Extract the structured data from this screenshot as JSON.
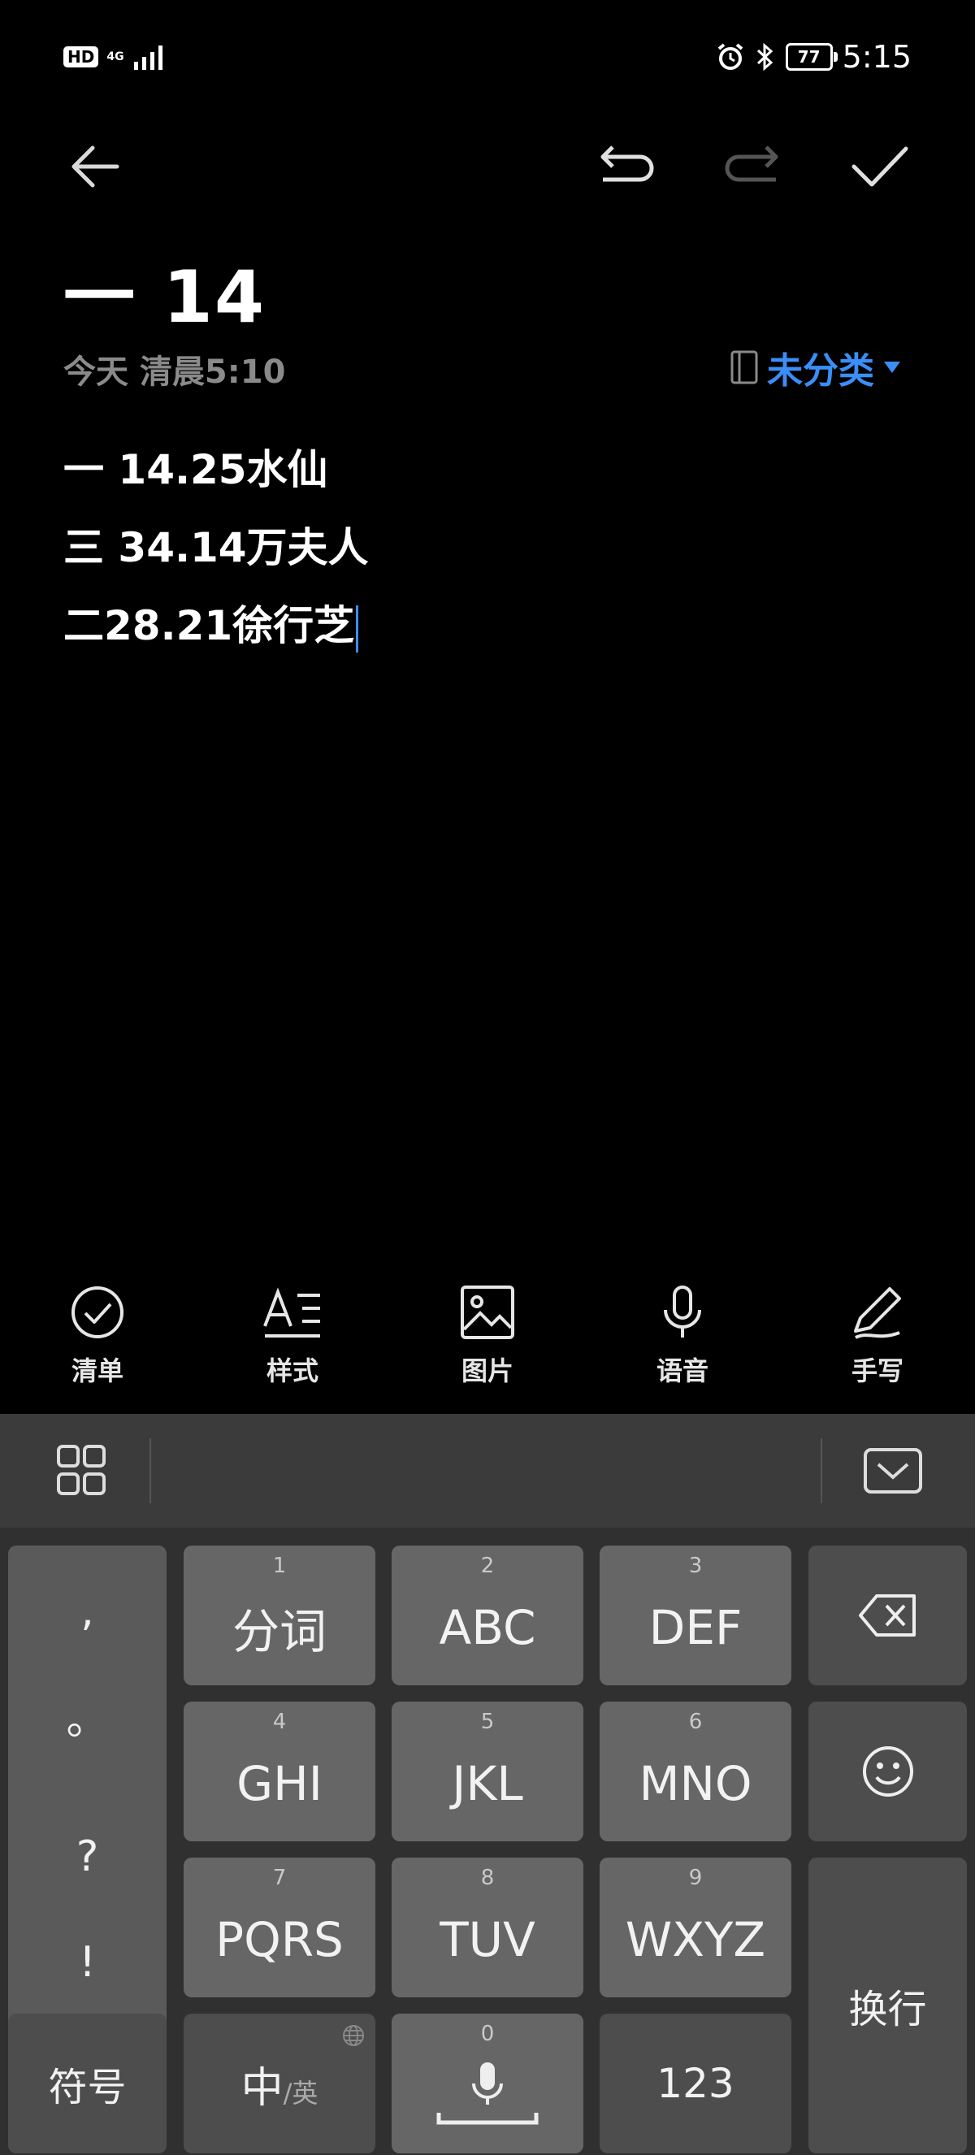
{
  "status_bar": {
    "hd": "HD",
    "network": "4G",
    "battery": "77",
    "time": "5:15"
  },
  "note": {
    "title": "一 14",
    "date": "今天 清晨5:10",
    "category": "未分类",
    "lines": [
      "一 14.25水仙",
      "三 34.14万夫人",
      "二28.21徐行芝"
    ]
  },
  "tools": {
    "checklist": "清单",
    "style": "样式",
    "image": "图片",
    "voice": "语音",
    "handwriting": "手写"
  },
  "keyboard": {
    "punct": [
      ",",
      "。",
      "?",
      "!"
    ],
    "rows": [
      [
        {
          "num": "1",
          "label": "分词"
        },
        {
          "num": "2",
          "label": "ABC"
        },
        {
          "num": "3",
          "label": "DEF"
        }
      ],
      [
        {
          "num": "4",
          "label": "GHI"
        },
        {
          "num": "5",
          "label": "JKL"
        },
        {
          "num": "6",
          "label": "MNO"
        }
      ],
      [
        {
          "num": "7",
          "label": "PQRS"
        },
        {
          "num": "8",
          "label": "TUV"
        },
        {
          "num": "9",
          "label": "WXYZ"
        }
      ]
    ],
    "symbols": "符号",
    "lang_main": "中",
    "lang_sub": "/英",
    "space_num": "0",
    "num_key": "123",
    "enter": "换行"
  },
  "icons": [
    "back-arrow-icon",
    "undo-icon",
    "redo-icon",
    "checkmark-icon",
    "notebook-icon",
    "dropdown-triangle-icon",
    "checklist-icon",
    "text-style-icon",
    "image-icon",
    "microphone-icon",
    "pen-icon",
    "grid-menu-icon",
    "keyboard-hide-icon",
    "backspace-icon",
    "emoji-icon",
    "globe-icon",
    "alarm-icon",
    "bluetooth-icon"
  ],
  "colors": {
    "accent": "#3a8ef6",
    "background": "#000000",
    "key": "#666666"
  }
}
